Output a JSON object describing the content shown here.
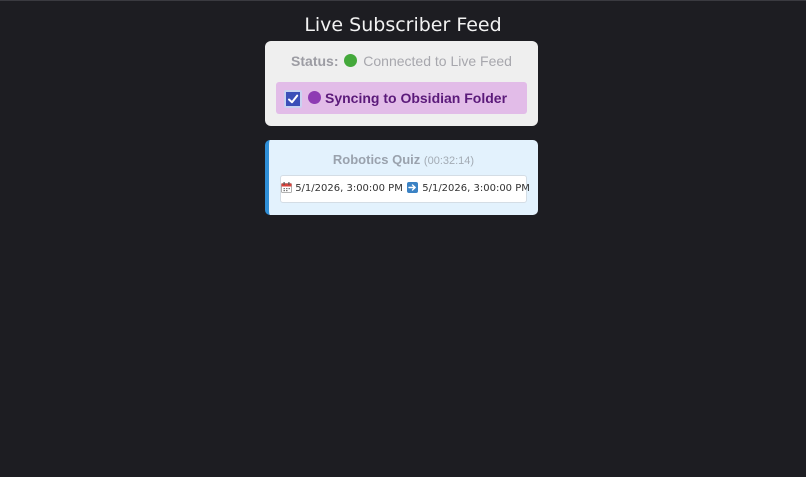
{
  "page": {
    "title": "Live Subscriber Feed"
  },
  "status": {
    "label": "Status:",
    "value": "Connected to Live Feed",
    "indicator_color": "#44a93b"
  },
  "sync": {
    "checked": true,
    "label": "Syncing to Obsidian Folder",
    "indicator_color": "#8e3bb3"
  },
  "event": {
    "name": "Robotics Quiz",
    "duration": "(00:32:14)",
    "start": "5/1/2026, 3:00:00 PM",
    "end": "5/1/2026, 3:00:00 PM",
    "accent_color": "#2f8fd8"
  }
}
